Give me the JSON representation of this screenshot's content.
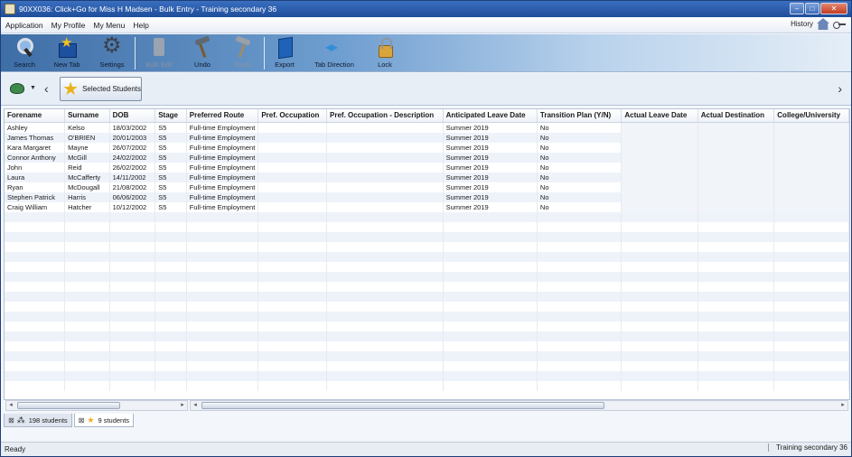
{
  "window": {
    "title": "90XX036: Click+Go for Miss H Madsen - Bulk Entry - Training secondary 36"
  },
  "menu": {
    "items": [
      "Application",
      "My Profile",
      "My Menu",
      "Help"
    ],
    "history_label": "History"
  },
  "ribbon": {
    "search": "Search",
    "new_tab": "New Tab",
    "settings": "Settings",
    "bulk_edit": "Bulk Edit",
    "undo": "Undo",
    "redo": "Redo",
    "export": "Export",
    "tab_direction": "Tab Direction",
    "lock": "Lock"
  },
  "subbar": {
    "selected_students": "Selected Students"
  },
  "grid": {
    "headers": [
      "Forename",
      "Surname",
      "DOB",
      "Stage",
      "Preferred Route",
      "Pref. Occupation",
      "Pref. Occupation - Description",
      "Anticipated Leave Date",
      "Transition Plan (Y/N)",
      "Actual Leave Date",
      "Actual Destination",
      "College/University"
    ],
    "rows": [
      [
        "Ashley",
        "Kelso",
        "18/03/2002",
        "S5",
        "Full-time Employment",
        "",
        "",
        "Summer 2019",
        "No",
        "",
        "",
        ""
      ],
      [
        "James Thomas",
        "O'BRIEN",
        "20/01/2003",
        "S5",
        "Full-time Employment",
        "",
        "",
        "Summer 2019",
        "No",
        "",
        "",
        ""
      ],
      [
        "Kara Margaret",
        "Mayne",
        "26/07/2002",
        "S5",
        "Full-time Employment",
        "",
        "",
        "Summer 2019",
        "No",
        "",
        "",
        ""
      ],
      [
        "Connor Anthony",
        "McGill",
        "24/02/2002",
        "S5",
        "Full-time Employment",
        "",
        "",
        "Summer 2019",
        "No",
        "",
        "",
        ""
      ],
      [
        "John",
        "Reid",
        "26/02/2002",
        "S5",
        "Full-time Employment",
        "",
        "",
        "Summer 2019",
        "No",
        "",
        "",
        ""
      ],
      [
        "Laura",
        "McCafferty",
        "14/11/2002",
        "S5",
        "Full-time Employment",
        "",
        "",
        "Summer 2019",
        "No",
        "",
        "",
        ""
      ],
      [
        "Ryan",
        "McDougall",
        "21/08/2002",
        "S5",
        "Full-time Employment",
        "",
        "",
        "Summer 2019",
        "No",
        "",
        "",
        ""
      ],
      [
        "Stephen Patrick",
        "Harris",
        "06/06/2002",
        "S5",
        "Full-time Employment",
        "",
        "",
        "Summer 2019",
        "No",
        "",
        "",
        ""
      ],
      [
        "Craig William",
        "Hatcher",
        "10/12/2002",
        "S5",
        "Full-time Employment",
        "",
        "",
        "Summer 2019",
        "No",
        "",
        "",
        ""
      ]
    ]
  },
  "tabs": [
    {
      "label": "198 students"
    },
    {
      "label": "9 students"
    }
  ],
  "status": {
    "left": "Ready",
    "right": "Training secondary 36"
  },
  "colors": {
    "titlebar": "#2a5caa",
    "accent_star": "#e9b21a"
  },
  "icons": {
    "search": "magnifier-icon",
    "new_tab": "star-folder-icon",
    "settings": "gear-icon",
    "bulk_edit": "bulk-edit-icon",
    "undo": "undo-hammer-icon",
    "redo": "redo-hammer-icon",
    "export": "export-book-icon",
    "tab_direction": "arrows-icon",
    "lock": "padlock-icon"
  }
}
